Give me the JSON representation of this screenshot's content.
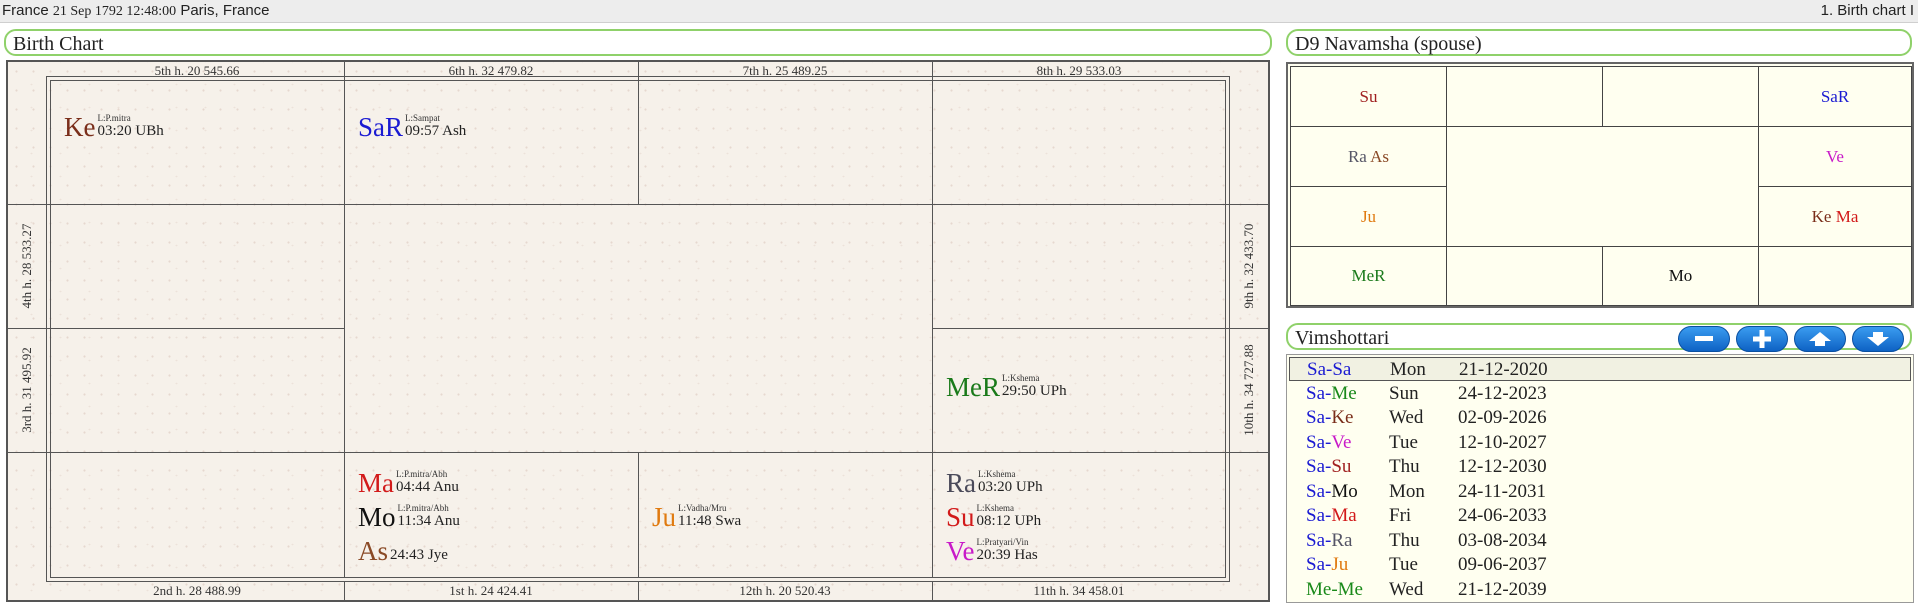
{
  "header": {
    "country": "France",
    "datetime": "21 Sep 1792 12:48:00",
    "place": "Paris, France",
    "chart_name": "1. Birth chart I"
  },
  "birth_chart": {
    "title": "Birth Chart",
    "house_labels": {
      "h5": "5th h.  20  545.66",
      "h6": "6th h.  32  479.82",
      "h7": "7th h.  25  489.25",
      "h8": "8th h.  29  533.03",
      "h4": "4th h.  28  533.27",
      "h3": "3rd h.  31  495.92",
      "h9": "9th h.  32  433.70",
      "h10": "10th h.  34  727.88",
      "h2": "2nd h.  28  488.99",
      "h1": "1st h.  24  424.41",
      "h12": "12th h.  20  520.43",
      "h11": "11th h.  34  458.01"
    },
    "planets": {
      "ke": {
        "abbr": "Ke",
        "lord": "L:P.mitra",
        "pos": "03:20 UBh",
        "color": "#7a2e1a"
      },
      "sar": {
        "abbr": "SaR",
        "lord": "L:Sampat",
        "pos": "09:57 Ash",
        "color": "#1a1ad2"
      },
      "mer": {
        "abbr": "MeR",
        "lord": "L:Kshema",
        "pos": "29:50 UPh",
        "color": "#1a7a1a"
      },
      "ma": {
        "abbr": "Ma",
        "lord": "L:P.mitra/Abh",
        "pos": "04:44 Anu",
        "color": "#d21a1a"
      },
      "mo": {
        "abbr": "Mo",
        "lord": "L:P.mitra/Abh",
        "pos": "11:34 Anu",
        "color": "#111111"
      },
      "as": {
        "abbr": "As",
        "lord": "",
        "pos": "24:43 Jye",
        "color": "#8a4a26"
      },
      "ju": {
        "abbr": "Ju",
        "lord": "L:Vadha/Mru",
        "pos": "11:48 Swa",
        "color": "#e07a10"
      },
      "ra": {
        "abbr": "Ra",
        "lord": "L:Kshema",
        "pos": "03:20 UPh",
        "color": "#4a4a5a"
      },
      "su": {
        "abbr": "Su",
        "lord": "L:Kshema",
        "pos": "08:12 UPh",
        "color": "#d21a1a"
      },
      "ve": {
        "abbr": "Ve",
        "lord": "L:Pratyari/Vin",
        "pos": "20:39 Has",
        "color": "#c81ac8"
      }
    }
  },
  "navamsha": {
    "title": "D9 Navamsha  (spouse)",
    "cells": {
      "su": {
        "label": "Su",
        "color": "#a02020"
      },
      "sar": {
        "label": "SaR",
        "color": "#1a1ad2"
      },
      "ra": {
        "label": "Ra",
        "color": "#555566"
      },
      "as": {
        "label": "As",
        "color": "#8a4a26"
      },
      "ve": {
        "label": "Ve",
        "color": "#c81ac8"
      },
      "ju": {
        "label": "Ju",
        "color": "#e07a10"
      },
      "ke": {
        "label": "Ke",
        "color": "#7a2e1a"
      },
      "ma": {
        "label": "Ma",
        "color": "#d21a1a"
      },
      "mer": {
        "label": "MeR",
        "color": "#1a7a1a"
      },
      "mo": {
        "label": "Mo",
        "color": "#111111"
      }
    }
  },
  "vimshottari": {
    "title": "Vimshottari",
    "buttons": [
      "minus-icon",
      "plus-icon",
      "arrow-up-icon",
      "arrow-down-icon"
    ],
    "rows": [
      {
        "a": "Sa",
        "b": "Sa",
        "ac": "#1a1ad2",
        "bc": "#1a1ad2",
        "day": "Mon",
        "date": "21-12-2020"
      },
      {
        "a": "Sa",
        "b": "Me",
        "ac": "#1a1ad2",
        "bc": "#1a8a1a",
        "day": "Sun",
        "date": "24-12-2023"
      },
      {
        "a": "Sa",
        "b": "Ke",
        "ac": "#1a1ad2",
        "bc": "#7a2e1a",
        "day": "Wed",
        "date": "02-09-2026"
      },
      {
        "a": "Sa",
        "b": "Ve",
        "ac": "#1a1ad2",
        "bc": "#c81ac8",
        "day": "Tue",
        "date": "12-10-2027"
      },
      {
        "a": "Sa",
        "b": "Su",
        "ac": "#1a1ad2",
        "bc": "#a02020",
        "day": "Thu",
        "date": "12-12-2030"
      },
      {
        "a": "Sa",
        "b": "Mo",
        "ac": "#1a1ad2",
        "bc": "#111111",
        "day": "Mon",
        "date": "24-11-2031"
      },
      {
        "a": "Sa",
        "b": "Ma",
        "ac": "#1a1ad2",
        "bc": "#d21a1a",
        "day": "Fri",
        "date": "24-06-2033"
      },
      {
        "a": "Sa",
        "b": "Ra",
        "ac": "#1a1ad2",
        "bc": "#555566",
        "day": "Thu",
        "date": "03-08-2034"
      },
      {
        "a": "Sa",
        "b": "Ju",
        "ac": "#1a1ad2",
        "bc": "#e07a10",
        "day": "Tue",
        "date": "09-06-2037"
      },
      {
        "a": "Me",
        "b": "Me",
        "ac": "#1a8a1a",
        "bc": "#1a8a1a",
        "day": "Wed",
        "date": "21-12-2039"
      }
    ]
  }
}
